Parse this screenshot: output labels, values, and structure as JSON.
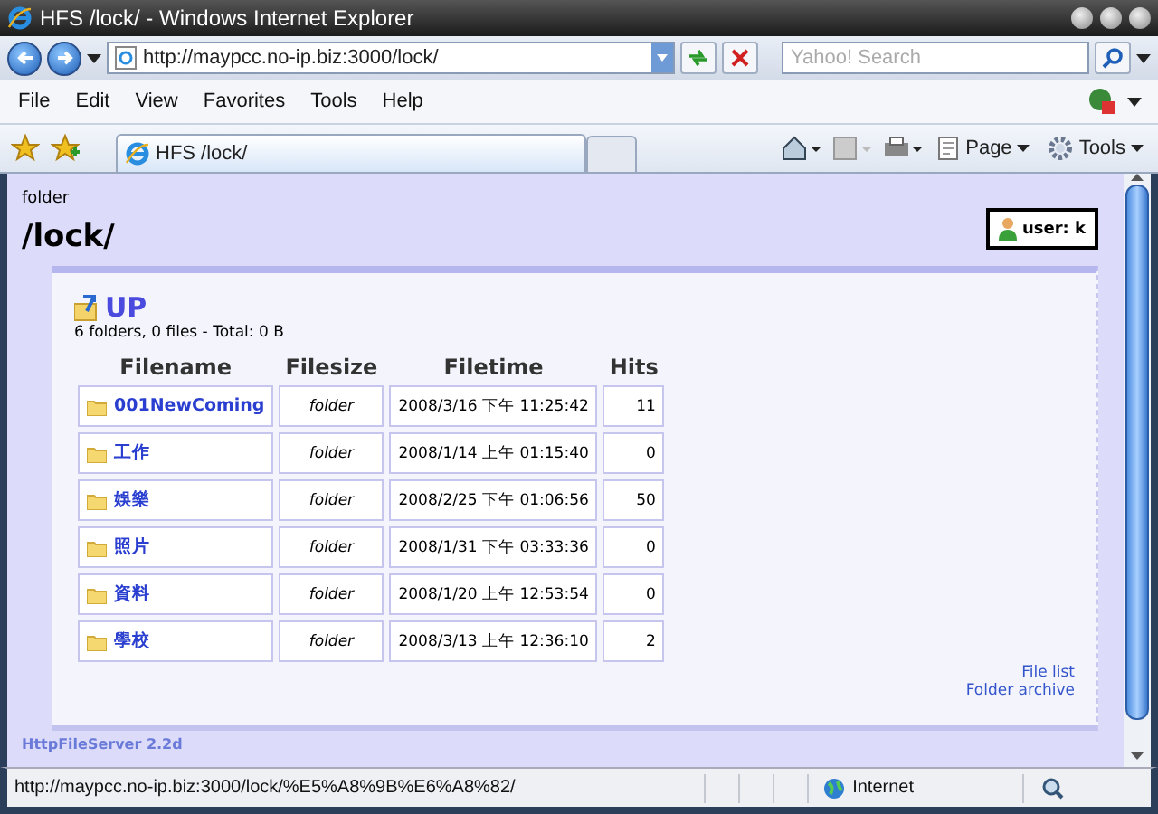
{
  "window": {
    "title": "HFS /lock/ - Windows Internet Explorer"
  },
  "address_bar": {
    "url": "http://maypcc.no-ip.biz:3000/lock/"
  },
  "search": {
    "placeholder": "Yahoo! Search"
  },
  "menu": [
    "File",
    "Edit",
    "View",
    "Favorites",
    "Tools",
    "Help"
  ],
  "tabs": [
    {
      "label": "HFS /lock/",
      "selected": true
    }
  ],
  "command_bar": [
    "Page",
    "Tools"
  ],
  "page": {
    "caption": "folder",
    "folder": "/lock/",
    "user": "user: k",
    "up": "UP",
    "summary": "6 folders, 0 files - Total: 0 B",
    "columns": [
      "Filename",
      "Filesize",
      "Filetime",
      "Hits"
    ],
    "rows": [
      {
        "name": "001NewComing",
        "size": "folder",
        "time": "2008/3/16 下午 11:25:42",
        "hits": "11"
      },
      {
        "name": "工作",
        "size": "folder",
        "time": "2008/1/14 上午 01:15:40",
        "hits": "0"
      },
      {
        "name": "娛樂",
        "size": "folder",
        "time": "2008/2/25 下午 01:06:56",
        "hits": "50"
      },
      {
        "name": "照片",
        "size": "folder",
        "time": "2008/1/31 下午 03:33:36",
        "hits": "0"
      },
      {
        "name": "資料",
        "size": "folder",
        "time": "2008/1/20 上午 12:53:54",
        "hits": "0"
      },
      {
        "name": "學校",
        "size": "folder",
        "time": "2008/3/13 上午 12:36:10",
        "hits": "2"
      }
    ],
    "links": [
      "File list",
      "Folder archive"
    ],
    "footer": "HttpFileServer 2.2d"
  },
  "status_bar": {
    "text": "http://maypcc.no-ip.biz:3000/lock/%E5%A8%9B%E6%A8%82/",
    "zone": "Internet"
  }
}
